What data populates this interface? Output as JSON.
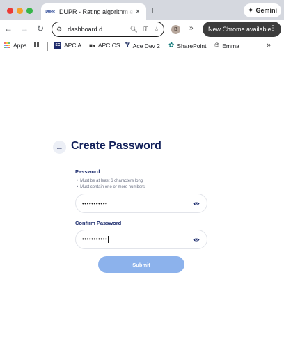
{
  "browser": {
    "tab_title": "DUPR - Rating algorithm engine",
    "tab_favicon_text": "DUPR",
    "gemini_label": "Gemini",
    "url": "dashboard.d...",
    "profile_initial": "B",
    "update_label": "New Chrome available",
    "bookmarks": {
      "apps": "Apps",
      "apc_a": "APC A",
      "apc_a_badge": "SC",
      "apc_cs": "APC CS",
      "ace_dev": "Ace Dev 2",
      "sharepoint": "SharePoint",
      "emma": "Emma"
    }
  },
  "page": {
    "title": "Create Password",
    "password_label": "Password",
    "rules": [
      "Must be at least 6 characters long",
      "Must contain one or more numbers"
    ],
    "password_value": "•••••••••••",
    "confirm_label": "Confirm Password",
    "confirm_value": "•••••••••••",
    "submit_label": "Submit"
  },
  "colors": {
    "title": "#12205a",
    "label": "#1a2a6c",
    "submit_bg": "#8cb2ec"
  },
  "icons": {
    "back": "arrow-left-icon",
    "eye": "eye-icon"
  }
}
